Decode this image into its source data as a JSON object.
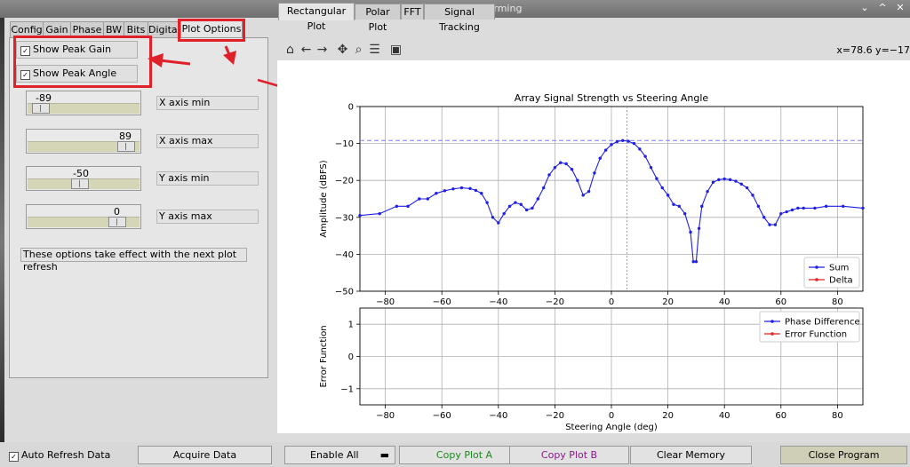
{
  "window": {
    "title": "Phased Array Beamforming",
    "buttons": [
      "⌄",
      "^",
      "✕"
    ]
  },
  "left_tabs": [
    {
      "label": "Config",
      "active": false
    },
    {
      "label": "Gain",
      "active": false
    },
    {
      "label": "Phase",
      "active": false
    },
    {
      "label": "BW",
      "active": false
    },
    {
      "label": "Bits",
      "active": false
    },
    {
      "label": "Digital",
      "active": false
    },
    {
      "label": "Plot Options",
      "active": true
    }
  ],
  "plot_options": {
    "checkboxes": [
      {
        "label": "Show Peak Gain",
        "checked": true
      },
      {
        "label": "Show Peak Angle",
        "checked": true
      }
    ],
    "sliders": [
      {
        "value": "-89",
        "label": "X axis min",
        "level": 0.02
      },
      {
        "value": "89",
        "label": "X axis max",
        "level": 0.98
      },
      {
        "value": "-50",
        "label": "Y axis min",
        "level": 0.5
      },
      {
        "value": "0",
        "label": "Y axis max",
        "level": 0.86
      }
    ],
    "note": "These options take effect with the next plot refresh"
  },
  "right_tabs": [
    {
      "label": "Rectangular Plot",
      "active": true
    },
    {
      "label": "Polar Plot",
      "active": false
    },
    {
      "label": "FFT",
      "active": false
    },
    {
      "label": "Signal Tracking",
      "active": false
    }
  ],
  "toolbar": {
    "icons": [
      "home-icon",
      "back-icon",
      "forward-icon",
      "pan-icon",
      "zoom-icon",
      "configure-icon",
      "save-icon"
    ],
    "coords": "x=78.6 y=−17"
  },
  "chart_data": [
    {
      "type": "line",
      "title": "Array Signal Strength vs Steering Angle",
      "xlabel": "",
      "ylabel": "Amplitude (dBFS)",
      "xlim": [
        -89,
        89
      ],
      "ylim": [
        -50,
        0
      ],
      "xticks": [
        -80,
        -60,
        -40,
        -20,
        0,
        20,
        40,
        60,
        80
      ],
      "yticks": [
        0,
        -10,
        -20,
        -30,
        -40,
        -50
      ],
      "grid": true,
      "legend": "lower-right",
      "peak_gain_line": -9.2,
      "peak_angle_line": 5.5,
      "series": [
        {
          "name": "Sum",
          "color": "#1f1fe6",
          "x": [
            -89,
            -82,
            -76,
            -72,
            -68,
            -65,
            -62,
            -59,
            -56,
            -53,
            -50,
            -48,
            -46,
            -44,
            -42,
            -40,
            -38,
            -36,
            -34,
            -32,
            -30,
            -28,
            -26,
            -24,
            -22,
            -20,
            -18,
            -16,
            -14,
            -12,
            -10,
            -8,
            -6,
            -4,
            -2,
            0,
            2,
            4,
            6,
            8,
            10,
            12,
            14,
            16,
            18,
            20,
            22,
            24,
            26,
            28,
            29,
            30,
            31,
            32,
            34,
            36,
            38,
            40,
            42,
            44,
            46,
            48,
            50,
            52,
            54,
            56,
            58,
            60,
            62,
            64,
            66,
            68,
            72,
            76,
            82,
            89
          ],
          "y": [
            -29.5,
            -29,
            -27,
            -27,
            -25,
            -25,
            -23.5,
            -22.8,
            -22.3,
            -22,
            -22.2,
            -22.7,
            -23.5,
            -26,
            -30,
            -31.5,
            -29,
            -27,
            -26,
            -26.5,
            -28,
            -27.5,
            -25,
            -22,
            -18.5,
            -16.5,
            -15.2,
            -15.5,
            -17,
            -20,
            -24,
            -23,
            -18,
            -14,
            -11.8,
            -10.3,
            -9.5,
            -9.2,
            -9.4,
            -10,
            -11.5,
            -13.5,
            -16.5,
            -19.5,
            -22,
            -24,
            -26.5,
            -27,
            -29,
            -34,
            -42,
            -42,
            -33,
            -27,
            -23,
            -20.5,
            -19.8,
            -19.6,
            -19.8,
            -20.2,
            -21,
            -22,
            -24,
            -27,
            -30,
            -32,
            -32,
            -29,
            -28.5,
            -28,
            -27.5,
            -27.5,
            -27.5,
            -27,
            -27,
            -27.5
          ]
        },
        {
          "name": "Delta",
          "color": "#e61f1f",
          "x": [],
          "y": []
        }
      ]
    },
    {
      "type": "line",
      "title": "",
      "xlabel": "Steering Angle (deg)",
      "ylabel": "Error Function",
      "xlim": [
        -89,
        89
      ],
      "ylim": [
        -1.5,
        1.5
      ],
      "xticks": [
        -80,
        -60,
        -40,
        -20,
        0,
        20,
        40,
        60,
        80
      ],
      "yticks": [
        1,
        0,
        -1
      ],
      "grid": true,
      "legend": "upper-right",
      "series": [
        {
          "name": "Phase Difference",
          "color": "#1f1fe6",
          "x": [],
          "y": []
        },
        {
          "name": "Error Function",
          "color": "#e61f1f",
          "x": [],
          "y": []
        }
      ]
    }
  ],
  "bottom": {
    "auto_refresh": {
      "label": "Auto Refresh Data",
      "checked": true
    },
    "buttons": [
      {
        "label": "Acquire Data",
        "color": "#000000"
      },
      {
        "label": "Enable All",
        "color": "#000000"
      },
      {
        "label": "Copy Plot A",
        "color": "#1a8a1a"
      },
      {
        "label": "Copy Plot B",
        "color": "#8a1a8a"
      },
      {
        "label": "Clear Memory",
        "color": "#000000"
      },
      {
        "label": "Close Program",
        "color": "#000000"
      }
    ]
  }
}
